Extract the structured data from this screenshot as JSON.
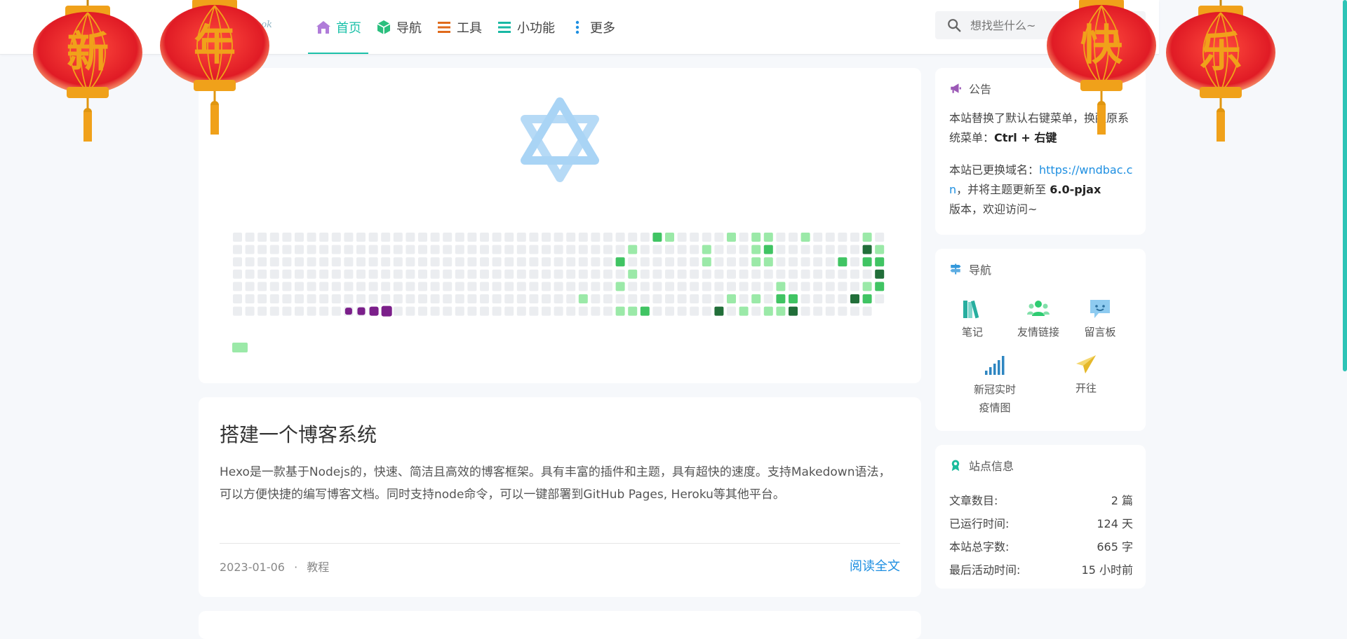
{
  "logo": {
    "text": "Yu Book"
  },
  "nav": {
    "items": [
      {
        "label": "首页",
        "icon": "home-icon",
        "active": true
      },
      {
        "label": "导航",
        "icon": "cube-icon"
      },
      {
        "label": "工具",
        "icon": "menu-lines-icon"
      },
      {
        "label": "小功能",
        "icon": "list-icon"
      },
      {
        "label": "更多",
        "icon": "more-vertical-icon"
      }
    ]
  },
  "search": {
    "placeholder": "想找些什么~"
  },
  "lanterns": [
    "新",
    "年",
    "快",
    "乐"
  ],
  "heatmap": {
    "colors": {
      "empty": "#ebedf0",
      "l1": "#9be9a8",
      "l2": "#40c463",
      "l3": "#216e39",
      "legend_purple": "#7b1f8a"
    }
  },
  "post": {
    "title": "搭建一个博客系统",
    "excerpt": "Hexo是一款基于Nodejs的，快速、简洁且高效的博客框架。具有丰富的插件和主题，具有超快的速度。支持Makedown语法，可以方便快捷的编写博客文档。同时支持node命令，可以一键部署到GitHub Pages, Heroku等其他平台。",
    "date": "2023-01-06",
    "separator": "·",
    "category": "教程",
    "read_more": "阅读全文"
  },
  "notice": {
    "title": "公告",
    "line1_prefix": "本站替换了默认右键菜单，换醒原系统菜单：",
    "line1_key": "Ctrl + 右键",
    "line2_prefix": "本站已更换域名：",
    "line2_link": "https://wndbac.cn",
    "line2_mid": "，并将主题更新至",
    "line2_version": "6.0-pjax",
    "line2_suffix": "版本，欢迎访问~"
  },
  "navcard": {
    "title": "导航",
    "items": [
      {
        "label": "笔记",
        "icon": "books-icon"
      },
      {
        "label": "友情链接",
        "icon": "people-icon"
      },
      {
        "label": "留言板",
        "icon": "chat-bubble-icon"
      },
      {
        "label": "新冠实时疫情图",
        "label_line1": "新冠实时",
        "label_line2": "疫情图",
        "icon": "signal-bars-icon"
      },
      {
        "label": "开往",
        "icon": "paper-plane-icon"
      }
    ]
  },
  "siteinfo": {
    "title": "站点信息",
    "rows": [
      {
        "label": "文章数目:",
        "value": "2 篇"
      },
      {
        "label": "已运行时间:",
        "value": "124 天"
      },
      {
        "label": "本站总字数:",
        "value": "665 字"
      },
      {
        "label": "最后活动时间:",
        "value": "15 小时前"
      }
    ]
  },
  "colors": {
    "accent": "#1cc1a9",
    "link": "#1e8fe1",
    "lantern_red": "#e8232f",
    "lantern_gold": "#f0a11a"
  }
}
